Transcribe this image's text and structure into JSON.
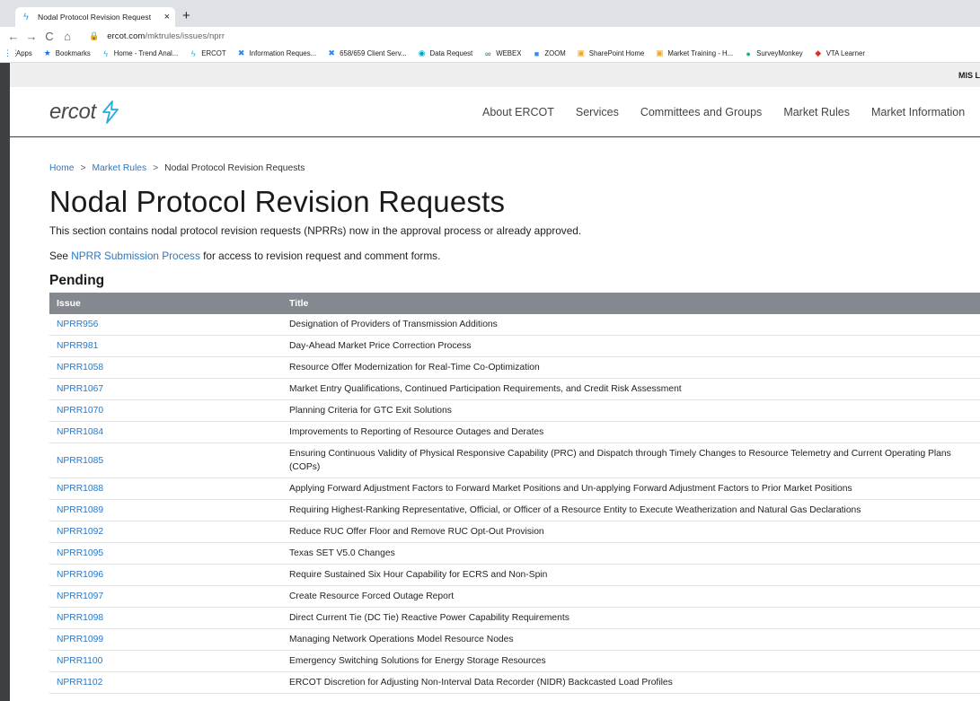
{
  "browser": {
    "tab_title": "Nodal Protocol Revision Request",
    "tab_close": "×",
    "new_tab": "+",
    "nav": {
      "back": "←",
      "forward": "→",
      "reload": "C",
      "home": "⌂"
    },
    "url_domain": "ercot.com",
    "url_path": "/mktrules/issues/nprr",
    "bookmarks": [
      {
        "label": "Apps",
        "icon": "apps-grid-icon",
        "glyph": "⋮⋮",
        "color": "#1a73e8"
      },
      {
        "label": "Bookmarks",
        "icon": "star-icon",
        "glyph": "★",
        "color": "#1a73e8"
      },
      {
        "label": "Home - Trend Anal...",
        "icon": "ercot-bolt-icon",
        "glyph": "ϟ",
        "color": "#27a9e1"
      },
      {
        "label": "ERCOT",
        "icon": "ercot-bolt-icon",
        "glyph": "ϟ",
        "color": "#27a9e1"
      },
      {
        "label": "Information Reques...",
        "icon": "confluence-icon",
        "glyph": "✖",
        "color": "#2684ff"
      },
      {
        "label": "658/659 Client Serv...",
        "icon": "confluence-icon",
        "glyph": "✖",
        "color": "#2684ff"
      },
      {
        "label": "Data Request",
        "icon": "circle-app-icon",
        "glyph": "◉",
        "color": "#00a3bf"
      },
      {
        "label": "WEBEX",
        "icon": "webex-icon",
        "glyph": "∞",
        "color": "#005e7d"
      },
      {
        "label": "ZOOM",
        "icon": "zoom-icon",
        "glyph": "■",
        "color": "#2d8cff"
      },
      {
        "label": "SharePoint Home",
        "icon": "sharepoint-icon",
        "glyph": "▣",
        "color": "#f5a623"
      },
      {
        "label": "Market Training - H...",
        "icon": "sharepoint-icon",
        "glyph": "▣",
        "color": "#f5a623"
      },
      {
        "label": "SurveyMonkey",
        "icon": "surveymonkey-icon",
        "glyph": "●",
        "color": "#00bf6f"
      },
      {
        "label": "VTA Learner",
        "icon": "vta-icon",
        "glyph": "◆",
        "color": "#d93025"
      }
    ]
  },
  "site": {
    "mis_label": "MIS L",
    "logo_text": "ercot",
    "nav": [
      "About ERCOT",
      "Services",
      "Committees and Groups",
      "Market Rules",
      "Market Information"
    ]
  },
  "breadcrumb": {
    "home": "Home",
    "sep": ">",
    "market_rules": "Market Rules",
    "current": "Nodal Protocol Revision Requests"
  },
  "page": {
    "title": "Nodal Protocol Revision Requests",
    "intro": "This section contains nodal protocol revision requests (NPRRs) now in the approval process or already approved.",
    "see_prefix": "See ",
    "see_link": "NPRR Submission Process",
    "see_suffix": " for access to revision request and comment forms.",
    "section_heading": "Pending"
  },
  "table": {
    "headers": [
      "Issue",
      "Title"
    ],
    "rows": [
      {
        "issue": "NPRR956",
        "title": "Designation of Providers of Transmission Additions"
      },
      {
        "issue": "NPRR981",
        "title": "Day-Ahead Market Price Correction Process"
      },
      {
        "issue": "NPRR1058",
        "title": "Resource Offer Modernization for Real-Time Co-Optimization"
      },
      {
        "issue": "NPRR1067",
        "title": "Market Entry Qualifications, Continued Participation Requirements, and Credit Risk Assessment"
      },
      {
        "issue": "NPRR1070",
        "title": "Planning Criteria for GTC Exit Solutions"
      },
      {
        "issue": "NPRR1084",
        "title": "Improvements to Reporting of Resource Outages and Derates"
      },
      {
        "issue": "NPRR1085",
        "title": "Ensuring Continuous Validity of Physical Responsive Capability (PRC) and Dispatch through Timely Changes to Resource Telemetry and Current Operating Plans (COPs)"
      },
      {
        "issue": "NPRR1088",
        "title": "Applying Forward Adjustment Factors to Forward Market Positions and Un-applying Forward Adjustment Factors to Prior Market Positions"
      },
      {
        "issue": "NPRR1089",
        "title": "Requiring Highest-Ranking Representative, Official, or Officer of a Resource Entity to Execute Weatherization and Natural Gas Declarations"
      },
      {
        "issue": "NPRR1092",
        "title": "Reduce RUC Offer Floor and Remove RUC Opt-Out Provision"
      },
      {
        "issue": "NPRR1095",
        "title": "Texas SET V5.0 Changes"
      },
      {
        "issue": "NPRR1096",
        "title": "Require Sustained Six Hour Capability for ECRS and Non-Spin"
      },
      {
        "issue": "NPRR1097",
        "title": "Create Resource Forced Outage Report"
      },
      {
        "issue": "NPRR1098",
        "title": "Direct Current Tie (DC Tie) Reactive Power Capability Requirements"
      },
      {
        "issue": "NPRR1099",
        "title": "Managing Network Operations Model Resource Nodes"
      },
      {
        "issue": "NPRR1100",
        "title": "Emergency Switching Solutions for Energy Storage Resources"
      },
      {
        "issue": "NPRR1102",
        "title": "ERCOT Discretion for Adjusting Non-Interval Data Recorder (NIDR) Backcasted Load Profiles"
      }
    ]
  }
}
